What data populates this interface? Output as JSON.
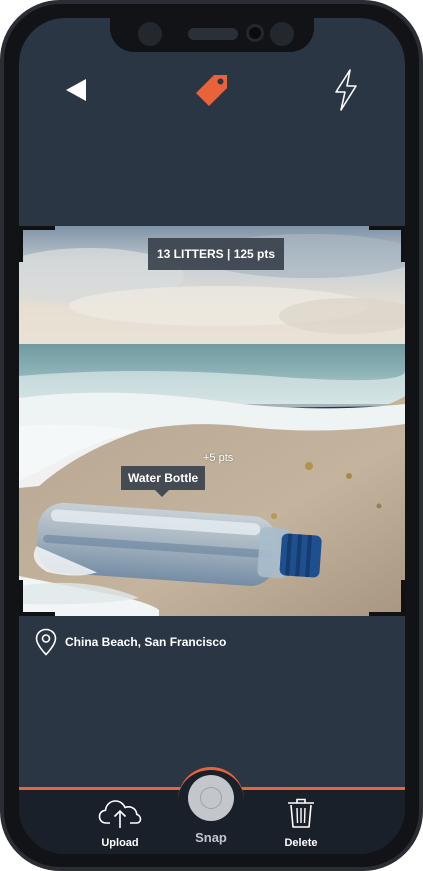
{
  "header": {
    "back_icon": "back-arrow-icon",
    "tag_icon": "tag-icon",
    "flash_icon": "flash-icon",
    "accent_color": "#e8633a"
  },
  "photo": {
    "score_text": "13 LITTERS | 125 pts",
    "detected_points": "+5 pts",
    "detected_label": "Water Bottle"
  },
  "location": {
    "icon": "map-pin-icon",
    "text": "China Beach, San Francisco"
  },
  "bottom_nav": {
    "upload_label": "Upload",
    "snap_label": "Snap",
    "delete_label": "Delete"
  }
}
